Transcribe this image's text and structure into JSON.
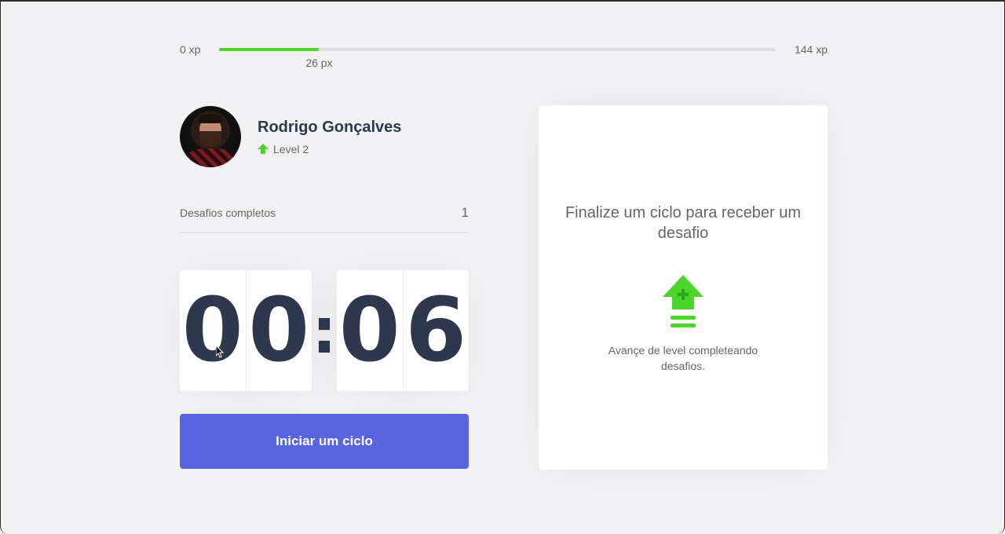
{
  "xp": {
    "min_label": "0 xp",
    "max_label": "144 xp",
    "current_label": "26 px",
    "progress_fraction": 0.18,
    "accent_color": "#4cd62b"
  },
  "profile": {
    "name": "Rodrigo Gonçalves",
    "level_label": "Level 2",
    "level_icon": "level-up-arrow-icon"
  },
  "challenges": {
    "label": "Desafios completos",
    "count": "1"
  },
  "countdown": {
    "minute_left": "0",
    "minute_right": "0",
    "separator": ":",
    "second_left": "0",
    "second_right": "6"
  },
  "start_button": {
    "label": "Iniciar um ciclo",
    "color": "#5965e0"
  },
  "challenge_card": {
    "title": "Finalize um ciclo para receber um desafio",
    "icon": "level-up-icon",
    "description": "Avançe de level completeando desafios."
  }
}
